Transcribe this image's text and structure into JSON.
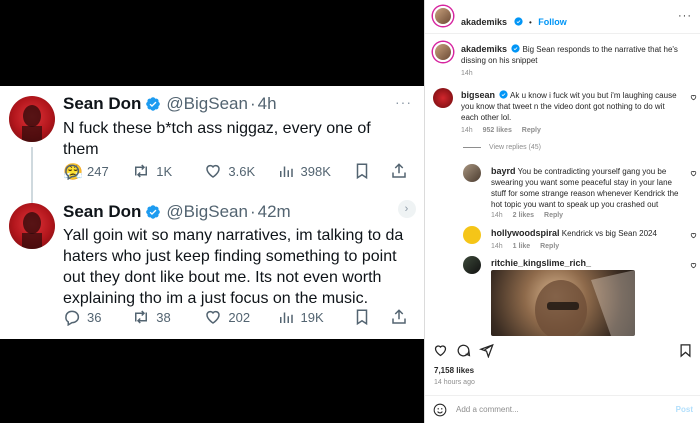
{
  "tweets": [
    {
      "name": "Sean Don",
      "handle": "@BigSean",
      "separator": "·",
      "time": "4h",
      "more": "···",
      "text": "N fuck these b*tch ass niggaz, every one of them",
      "emoji": "😤",
      "stats": {
        "replies": "247",
        "retweets": "1K",
        "likes": "3.6K",
        "views": "398K"
      }
    },
    {
      "name": "Sean Don",
      "handle": "@BigSean",
      "separator": "·",
      "time": "42m",
      "more": "›",
      "text": "Yall goin wit so many narratives, im talking to da haters who just keep finding something to point out they dont like bout me. Its not even worth explaining tho im a just focus on the music.",
      "stats": {
        "replies": "36",
        "retweets": "38",
        "likes": "202",
        "views": "19K"
      }
    }
  ],
  "instagram": {
    "header": {
      "username": "akademiks",
      "dot": "•",
      "follow": "Follow",
      "more": "···"
    },
    "caption": {
      "username": "akademiks",
      "text": "Big Sean responds to the narrative that he's dissing on his snippet",
      "time": "14h"
    },
    "comments": [
      {
        "username": "bigsean",
        "text": "Ak u know i fuck wit you but i'm laughing cause you know that tweet n the video dont got nothing to do wit each other lol.",
        "time": "14h",
        "likes": "952 likes",
        "reply": "Reply"
      },
      {
        "username": "bayrd",
        "text": "You be contradicting yourself gang you be swearing you want some peaceful stay in your lane stuff for some strange reason whenever Kendrick the hot topic you want to speak up you crashed out",
        "time": "14h",
        "likes": "2 likes",
        "reply": "Reply"
      },
      {
        "username": "hollywoodspiral",
        "text": "Kendrick vs big Sean 2024",
        "time": "14h",
        "likes": "1 like",
        "reply": "Reply"
      },
      {
        "username": "ritchie_kingslime_rich_",
        "text": ""
      }
    ],
    "view_replies": "View replies (45)",
    "likes_count": "7,158 likes",
    "time_ago": "14 hours ago",
    "add_comment_placeholder": "Add a comment...",
    "post_label": "Post"
  },
  "colors": {
    "ig_link": "#0095f6",
    "x_verified": "#1d9bf0",
    "thread_line": "#cfd9de"
  }
}
